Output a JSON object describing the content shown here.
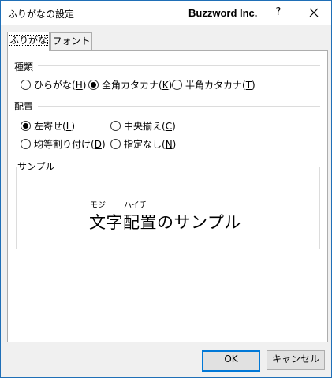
{
  "window": {
    "title": "ふりがなの設定",
    "brand": "Buzzword Inc.",
    "help": "?",
    "close_icon": "close-icon"
  },
  "tabs": [
    {
      "label": "ふりがな",
      "active": true
    },
    {
      "label": "フォント",
      "active": false
    }
  ],
  "kind": {
    "label": "種類",
    "options": [
      {
        "text": "ひらがな(",
        "key": "H",
        "checked": false
      },
      {
        "text": "全角カタカナ(",
        "key": "K",
        "checked": true
      },
      {
        "text": "半角カタカナ(",
        "key": "T",
        "checked": false
      }
    ]
  },
  "alignment": {
    "label": "配置",
    "options": [
      {
        "text": "左寄せ(",
        "key": "L",
        "checked": true
      },
      {
        "text": "中央揃え(",
        "key": "C",
        "checked": false
      },
      {
        "text": "均等割り付け(",
        "key": "D",
        "checked": false
      },
      {
        "text": "指定なし(",
        "key": "N",
        "checked": false
      }
    ]
  },
  "sample": {
    "label": "サンプル",
    "ruby_1": "モジ",
    "ruby_2": "ハイチ",
    "text": "文字配置のサンプル"
  },
  "buttons": {
    "ok": "OK",
    "cancel": "キャンセル"
  },
  "colors": {
    "accent": "#0078d7",
    "frame": "#1f6fb7"
  }
}
